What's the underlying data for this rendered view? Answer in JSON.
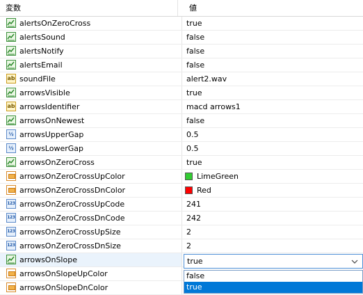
{
  "header": {
    "name_col": "変数",
    "value_col": "値"
  },
  "rows": [
    {
      "name": "alertsOnZeroCross",
      "type": "bool",
      "value": "true"
    },
    {
      "name": "alertsSound",
      "type": "bool",
      "value": "false"
    },
    {
      "name": "alertsNotify",
      "type": "bool",
      "value": "false"
    },
    {
      "name": "alertsEmail",
      "type": "bool",
      "value": "false"
    },
    {
      "name": "soundFile",
      "type": "string",
      "value": "alert2.wav"
    },
    {
      "name": "arrowsVisible",
      "type": "bool",
      "value": "true"
    },
    {
      "name": "arrowsIdentifier",
      "type": "string",
      "value": "macd arrows1"
    },
    {
      "name": "arrowsOnNewest",
      "type": "bool",
      "value": "false"
    },
    {
      "name": "arrowsUpperGap",
      "type": "double",
      "value": "0.5"
    },
    {
      "name": "arrowsLowerGap",
      "type": "double",
      "value": "0.5"
    },
    {
      "name": "arrowsOnZeroCross",
      "type": "bool",
      "value": "true"
    },
    {
      "name": "arrowsOnZeroCrossUpColor",
      "type": "color",
      "value": "LimeGreen",
      "swatch": "#32cd32"
    },
    {
      "name": "arrowsOnZeroCrossDnColor",
      "type": "color",
      "value": "Red",
      "swatch": "#ff0000"
    },
    {
      "name": "arrowsOnZeroCrossUpCode",
      "type": "int",
      "value": "241"
    },
    {
      "name": "arrowsOnZeroCrossDnCode",
      "type": "int",
      "value": "242"
    },
    {
      "name": "arrowsOnZeroCrossUpSize",
      "type": "int",
      "value": "2"
    },
    {
      "name": "arrowsOnZeroCrossDnSize",
      "type": "int",
      "value": "2"
    },
    {
      "name": "arrowsOnSlope",
      "type": "bool",
      "value": "true",
      "selected": true
    },
    {
      "name": "arrowsOnSlopeUpColor",
      "type": "color",
      "value": ""
    },
    {
      "name": "arrowsOnSlopeDnColor",
      "type": "color",
      "value": ""
    }
  ],
  "icons": {
    "bool": "bool-icon",
    "string": "string-icon",
    "string_glyph": "ab",
    "double": "double-icon",
    "double_glyph": "½",
    "int": "int-icon",
    "int_glyph": "123",
    "color": "color-icon"
  },
  "dropdown": {
    "options": [
      "false",
      "true"
    ],
    "highlighted": "true"
  },
  "colors": {
    "selection": "#0078d7",
    "row_selected": "#eaf3fc",
    "focus_border": "#4d8fd6"
  }
}
